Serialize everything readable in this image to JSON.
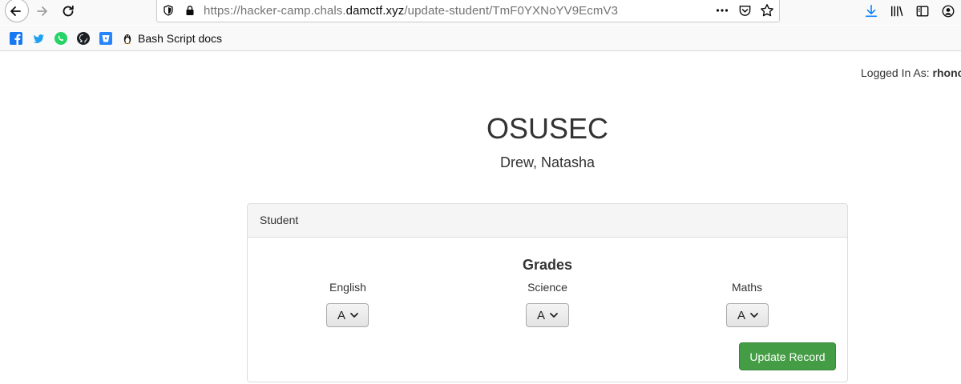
{
  "browser": {
    "url_prefix": "https://hacker-camp.chals.",
    "url_domain": "damctf.xyz",
    "url_path": "/update-student/TmF0YXNoYV9EcmV3",
    "bookmark_label": "Bash Script docs",
    "accent_color": "#0a84ff"
  },
  "header": {
    "logged_in_label": "Logged In As:",
    "logged_in_user": "rhonc"
  },
  "page": {
    "title": "OSUSEC",
    "student_name": "Drew, Natasha"
  },
  "panel": {
    "heading": "Student",
    "grades_title": "Grades",
    "subjects": [
      {
        "label": "English",
        "value": "A"
      },
      {
        "label": "Science",
        "value": "A"
      },
      {
        "label": "Maths",
        "value": "A"
      }
    ],
    "update_button": "Update Record",
    "button_color": "#449d44"
  }
}
